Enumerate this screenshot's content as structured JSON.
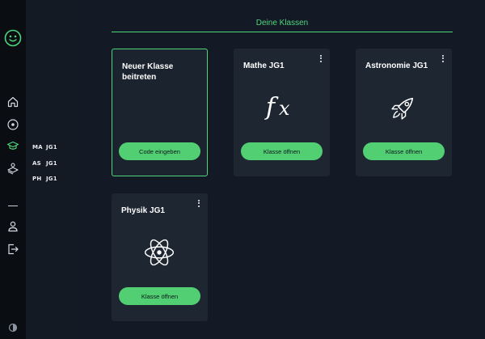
{
  "sidebar": {
    "icons": [
      "home-icon",
      "explore-icon",
      "classes-icon",
      "library-icon",
      "profile-icon",
      "logout-icon"
    ]
  },
  "classes_nav": {
    "items": [
      {
        "code": "MA",
        "name": "JG1"
      },
      {
        "code": "AS",
        "name": "JG1"
      },
      {
        "code": "PH",
        "name": "JG1"
      }
    ]
  },
  "main": {
    "title": "Deine Klassen",
    "join_card": {
      "title": "Neuer Klasse beitreten",
      "button": "Code eingeben"
    },
    "cards": [
      {
        "title": "Mathe JG1",
        "icon": "function-icon",
        "button": "Klasse öffnen"
      },
      {
        "title": "Astronomie JG1",
        "icon": "rocket-icon",
        "button": "Klasse öffnen"
      },
      {
        "title": "Physik JG1",
        "icon": "atom-icon",
        "button": "Klasse öffnen"
      }
    ]
  },
  "colors": {
    "accent": "#4fd67a",
    "button": "#52cf72",
    "card": "#1e2632"
  }
}
